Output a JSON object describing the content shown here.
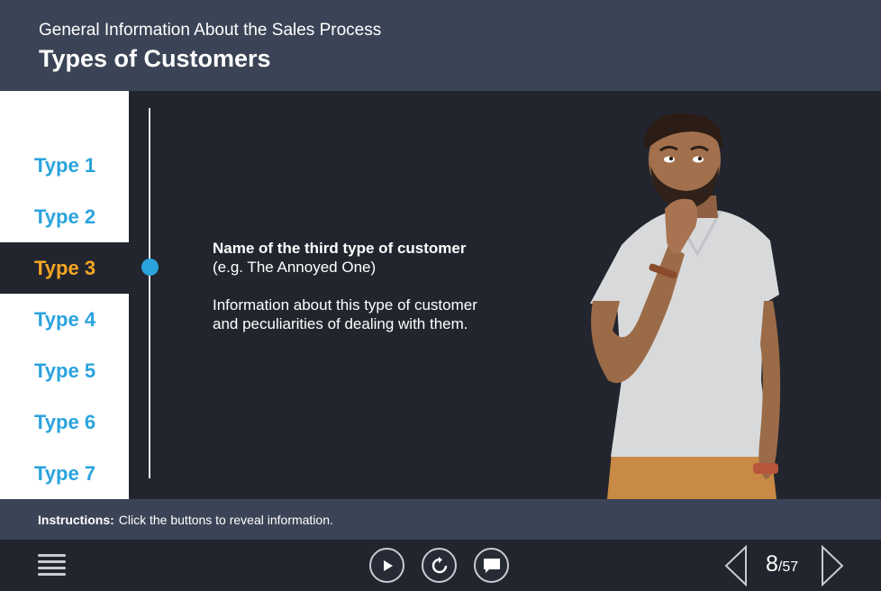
{
  "header": {
    "subtitle": "General Information About the Sales Process",
    "title": "Types of Customers"
  },
  "sidebar": {
    "active_index": 2,
    "items": [
      {
        "label": "Type 1"
      },
      {
        "label": "Type 2"
      },
      {
        "label": "Type 3"
      },
      {
        "label": "Type 4"
      },
      {
        "label": "Type 5"
      },
      {
        "label": "Type 6"
      },
      {
        "label": "Type 7"
      }
    ]
  },
  "content": {
    "name_line": "Name of the third type of customer",
    "example_line": "(e.g. The Annoyed One)",
    "info_line1": "Information about this type of customer",
    "info_line2": "and peculiarities of dealing with them."
  },
  "instructions": {
    "label": "Instructions:",
    "text": "Click the buttons to reveal information."
  },
  "player": {
    "current_page": "8",
    "total_pages": "/57",
    "icons": [
      "menu-icon",
      "play-icon",
      "replay-icon",
      "comment-icon",
      "prev-arrow-icon",
      "next-arrow-icon"
    ]
  },
  "colors": {
    "header_bg": "#3b4456",
    "body_bg": "#22252e",
    "tab_text": "#2aa3dd",
    "active_tab_text": "#f5a623",
    "timeline_dot": "#2aa3dd"
  }
}
